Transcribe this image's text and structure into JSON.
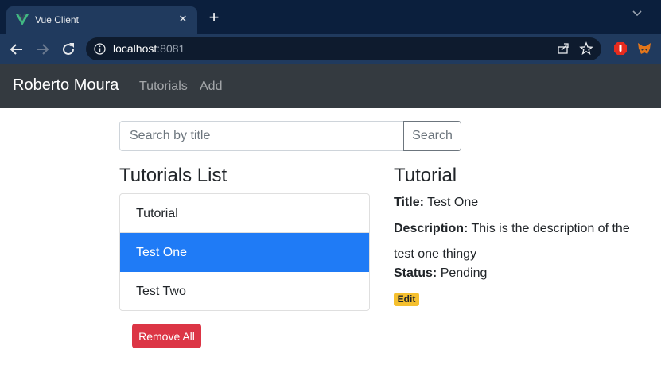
{
  "browser": {
    "tab_title": "Vue Client",
    "tab_close": "✕",
    "new_tab": "+",
    "url_host": "localhost",
    "url_port": ":8081"
  },
  "navbar": {
    "brand": "Roberto Moura",
    "links": [
      "Tutorials",
      "Add"
    ]
  },
  "search": {
    "placeholder": "Search by title",
    "value": "",
    "button": "Search"
  },
  "list": {
    "title": "Tutorials List",
    "items": [
      "Tutorial",
      "Test One",
      "Test Two"
    ],
    "active_index": 1,
    "remove_button": "Remove All"
  },
  "detail": {
    "title": "Tutorial",
    "title_label": "Title:",
    "title_value": "Test One",
    "description_label": "Description:",
    "description_value": "This is the description of the test one thingy",
    "status_label": "Status:",
    "status_value": "Pending",
    "edit_label": "Edit"
  },
  "colors": {
    "navbar_bg": "#343a40",
    "active_item": "#1f7bf6",
    "danger": "#dc3545",
    "warning": "#f5c02f"
  }
}
